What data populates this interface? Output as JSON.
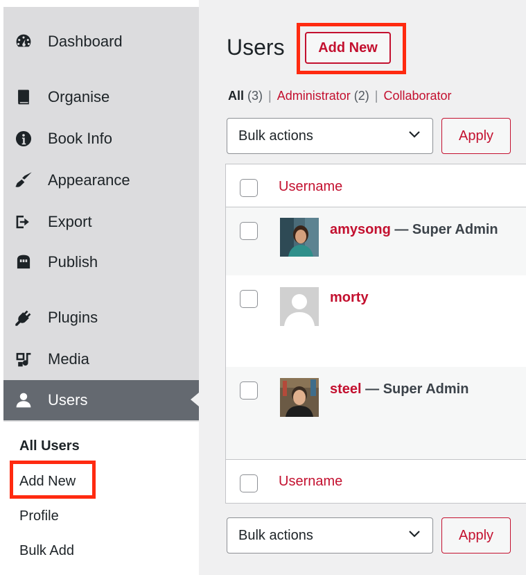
{
  "sidebar": {
    "items": [
      {
        "label": "Dashboard",
        "icon": "dashboard-icon"
      },
      {
        "label": "Organise",
        "icon": "book-icon"
      },
      {
        "label": "Book Info",
        "icon": "info-icon"
      },
      {
        "label": "Appearance",
        "icon": "paintbrush-icon"
      },
      {
        "label": "Export",
        "icon": "export-icon"
      },
      {
        "label": "Publish",
        "icon": "store-icon"
      },
      {
        "label": "Plugins",
        "icon": "plugin-icon"
      },
      {
        "label": "Media",
        "icon": "media-icon"
      },
      {
        "label": "Users",
        "icon": "user-icon",
        "active": true
      }
    ],
    "submenu": [
      {
        "label": "All Users",
        "current": true
      },
      {
        "label": "Add New"
      },
      {
        "label": "Profile"
      },
      {
        "label": "Bulk Add"
      }
    ]
  },
  "header": {
    "title": "Users",
    "add_new": "Add New"
  },
  "filters": {
    "all": "All",
    "all_count": "(3)",
    "separator": "|",
    "administrator": "Administrator",
    "administrator_count": "(2)",
    "collaborator": "Collaborator"
  },
  "bulk": {
    "label": "Bulk actions",
    "apply": "Apply"
  },
  "table": {
    "column_username": "Username",
    "users": [
      {
        "username": "amysong",
        "role": " — Super Admin"
      },
      {
        "username": "morty",
        "role": ""
      },
      {
        "username": "steel",
        "role": " — Super Admin"
      }
    ]
  },
  "colors": {
    "accent": "#c3102f",
    "highlight": "#ff2a10",
    "sidebar_bg": "#dcdcde",
    "sidebar_active": "#646970"
  }
}
